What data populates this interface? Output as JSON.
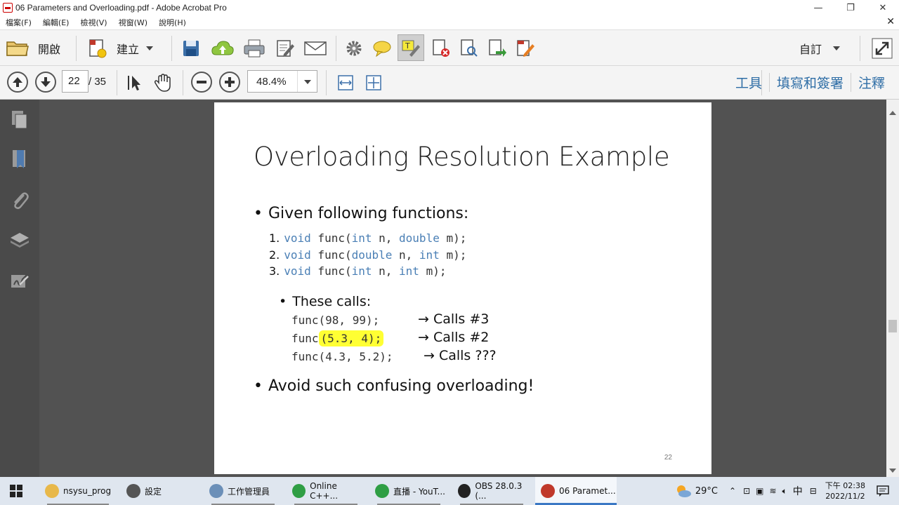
{
  "window": {
    "title": "06 Parameters and Overloading.pdf - Adobe Acrobat Pro",
    "minimize": "—",
    "restore": "❐",
    "close": "✕"
  },
  "menu": {
    "items": [
      "檔案(F)",
      "編輯(E)",
      "檢視(V)",
      "視窗(W)",
      "說明(H)"
    ],
    "close_doc": "✕"
  },
  "toolbar": {
    "open_label": "開啟",
    "create_label": "建立",
    "customize_label": "自訂"
  },
  "nav": {
    "page_current": "22",
    "page_total": "/ 35",
    "zoom": "48.4%"
  },
  "panels": [
    "工具",
    "填寫和簽署",
    "注釋"
  ],
  "slide": {
    "title": "Overloading Resolution Example",
    "bullet1": "Given following functions:",
    "functions": [
      {
        "num": "1.",
        "parts": [
          [
            "kw",
            "void"
          ],
          [
            "tx",
            " func("
          ],
          [
            "kw",
            "int"
          ],
          [
            "tx",
            " n, "
          ],
          [
            "kw",
            "double"
          ],
          [
            "tx",
            " m);"
          ]
        ]
      },
      {
        "num": "2.",
        "parts": [
          [
            "kw",
            "void"
          ],
          [
            "tx",
            " func("
          ],
          [
            "kw",
            "double"
          ],
          [
            "tx",
            " n, "
          ],
          [
            "kw",
            "int"
          ],
          [
            "tx",
            " m);"
          ]
        ]
      },
      {
        "num": "3.",
        "parts": [
          [
            "kw",
            "void"
          ],
          [
            "tx",
            " func("
          ],
          [
            "kw",
            "int"
          ],
          [
            "tx",
            " n, "
          ],
          [
            "kw",
            "int"
          ],
          [
            "tx",
            " m);"
          ]
        ]
      }
    ],
    "sub_bullet": "These calls:",
    "calls": [
      {
        "code": "func(98, 99);",
        "result": "→ Calls #3"
      },
      {
        "code_pre": "func",
        "code_hl": "(5.3, 4);",
        "result": "→ Calls #2"
      },
      {
        "code": "func(4.3, 5.2);",
        "result": "→ Calls ???"
      }
    ],
    "bullet2": "Avoid such confusing overloading!",
    "page_number": "22"
  },
  "taskbar": {
    "tasks": [
      {
        "label": "nsysu_prog",
        "color": "#e8b84a"
      },
      {
        "label": "設定",
        "color": "#555555"
      },
      {
        "label": "工作管理員",
        "color": "#6b8fb8"
      },
      {
        "label": "Online C++...",
        "color": "#2f9e44"
      },
      {
        "label": "直播 - YouT...",
        "color": "#2f9e44"
      },
      {
        "label": "OBS 28.0.3 (...",
        "color": "#222222"
      },
      {
        "label": "06 Paramet...",
        "color": "#c0392b"
      }
    ],
    "weather": "29°C",
    "ime": "中",
    "time": "下午 02:38",
    "date": "2022/11/2"
  }
}
